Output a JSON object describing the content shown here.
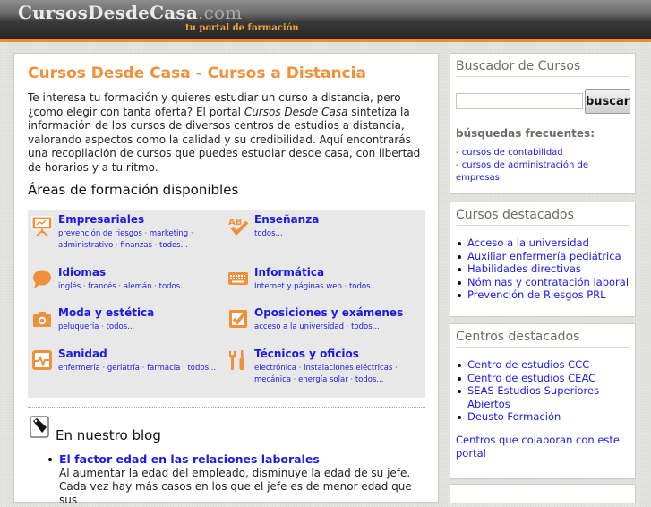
{
  "header": {
    "logo_main": "CursosDesdeCasa",
    "logo_tld": ".com",
    "tagline": "tu portal de formación",
    "accent_color": "#f08a28"
  },
  "main": {
    "title": "Cursos Desde Casa - Cursos a Distancia",
    "intro_before": "Te interesa tu formación y quieres estudiar un curso a distancia, pero ¿como elegir con tanta oferta? El portal ",
    "intro_em": "Cursos Desde Casa",
    "intro_after": " sintetiza la información de los cursos de diversos centros de estudios a distancia, valorando aspectos como la calidad y su credibilidad. Aquí encontrarás una recopilación de cursos que puedes estudiar desde casa, con libertad de horarios y a tu ritmo.",
    "areas_title": "Áreas de formación disponibles",
    "areas": [
      {
        "name": "Empresariales",
        "icon": "presentation-board-icon",
        "links": [
          "prevención de riesgos",
          "marketing",
          "administrativo",
          "finanzas",
          "todos..."
        ]
      },
      {
        "name": "Enseñanza",
        "icon": "ab-check-icon",
        "links": [
          "todos..."
        ]
      },
      {
        "name": "Idiomas",
        "icon": "speech-bubble-icon",
        "links": [
          "inglés",
          "francés",
          "alemán",
          "todos..."
        ]
      },
      {
        "name": "Informática",
        "icon": "keyboard-icon",
        "links": [
          "Internet y páginas web",
          "todos..."
        ]
      },
      {
        "name": "Moda y estética",
        "icon": "camera-icon",
        "links": [
          "peluquería",
          "todos..."
        ]
      },
      {
        "name": "Oposiciones y exámenes",
        "icon": "checkbox-icon",
        "links": [
          "acceso a la universidad",
          "todos..."
        ]
      },
      {
        "name": "Sanidad",
        "icon": "heartbeat-monitor-icon",
        "links": [
          "enfermería",
          "geriatría",
          "farmacia",
          "todos..."
        ]
      },
      {
        "name": "Técnicos y oficios",
        "icon": "tools-icon",
        "links": [
          "electrónica",
          "instalaciones eléctricas",
          "mecánica",
          "energía solar",
          "todos..."
        ]
      }
    ],
    "link_separator": " · ",
    "blog": {
      "title": "En nuestro blog",
      "posts": [
        {
          "title": "El factor edad en las relaciones laborales",
          "excerpt": "Al aumentar la edad del empleado, disminuye la edad de su jefe. Cada vez hay más casos en los que el jefe es de menor edad que sus"
        }
      ]
    }
  },
  "sidebar": {
    "search": {
      "title": "Buscador de Cursos",
      "input_value": "",
      "button_label": "buscar",
      "frequent_title": "búsquedas frecuentes:",
      "frequent": [
        "cursos de contabilidad",
        "cursos de administración de empresas"
      ]
    },
    "featured_courses": {
      "title": "Cursos destacados",
      "items": [
        "Acceso a la universidad",
        "Auxiliar enfermería pediátrica",
        "Habilidades directivas",
        "Nóminas y contratación laboral",
        "Prevención de Riesgos PRL"
      ]
    },
    "featured_centers": {
      "title": "Centros destacados",
      "items": [
        "Centro de estudios CCC",
        "Centro de estudios CEAC",
        "SEAS Estudios Superiores Abiertos",
        "Deusto Formación"
      ],
      "footer_link": "Centros que colaboran con este portal"
    }
  }
}
